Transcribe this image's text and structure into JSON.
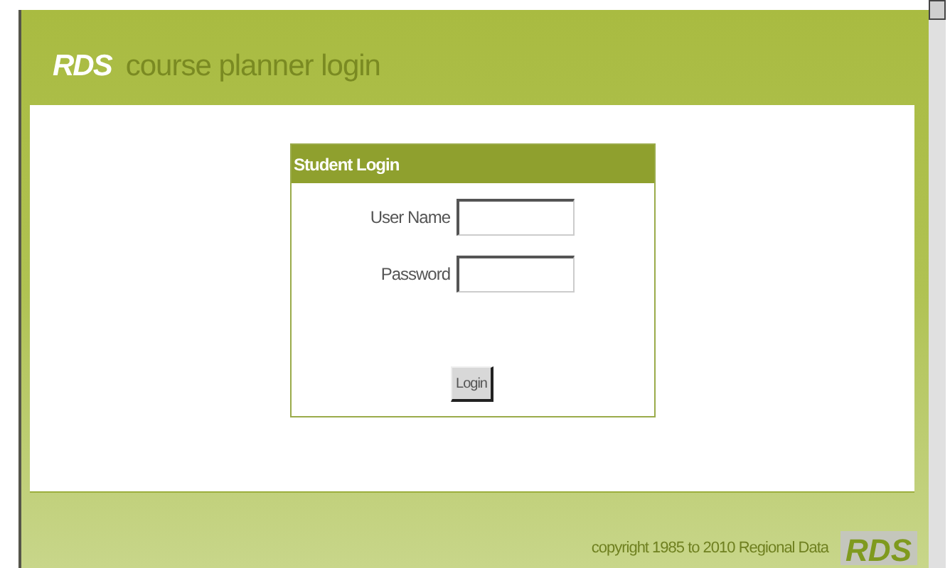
{
  "header": {
    "logo": "RDS",
    "title": "course planner login"
  },
  "login_panel": {
    "title": "Student Login",
    "fields": [
      {
        "label": "User Name"
      },
      {
        "label": "Password"
      }
    ],
    "button": "Login"
  },
  "footer": {
    "copyright": "copyright 1985 to 2010 Regional Data",
    "logo": "RDS"
  }
}
